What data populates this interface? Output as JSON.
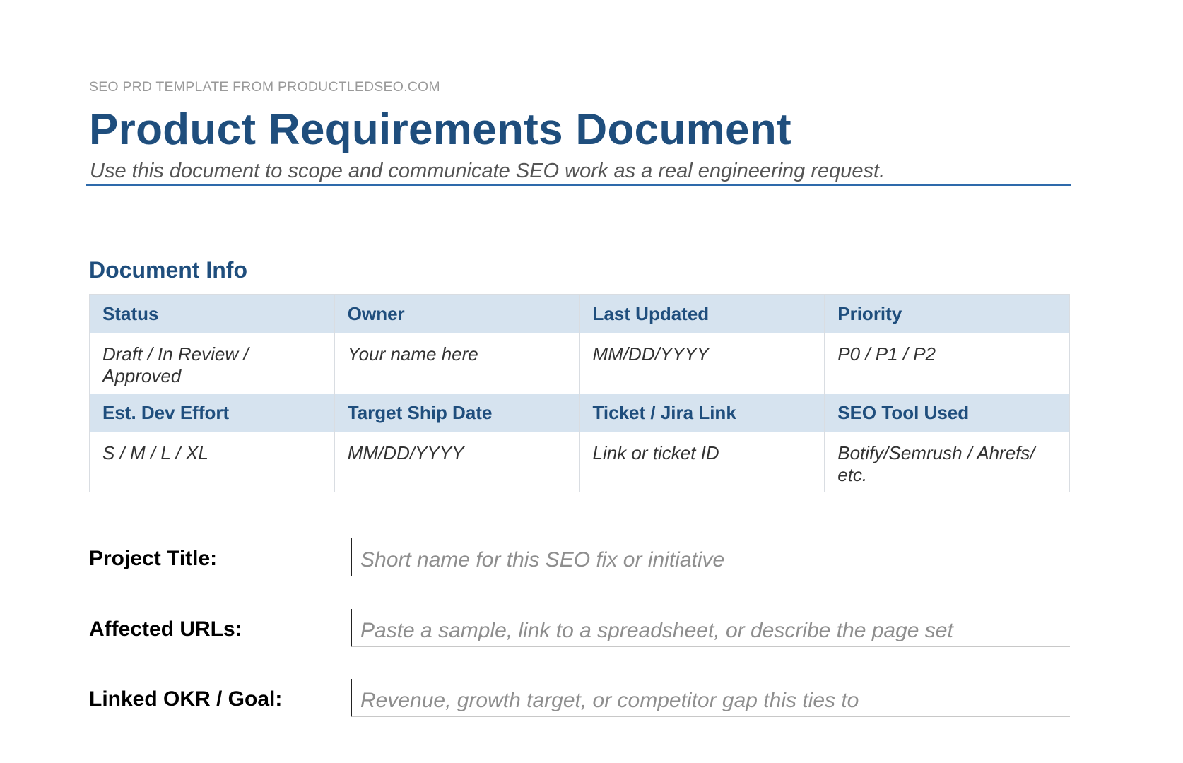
{
  "header": {
    "eyebrow": "SEO PRD TEMPLATE FROM PRODUCTLEDSEO.COM",
    "title": "Product Requirements Document",
    "subtitle": "Use this document to scope and communicate SEO work as a real engineering request."
  },
  "document_info": {
    "heading": "Document Info",
    "rows": [
      {
        "headers": [
          "Status",
          "Owner",
          "Last Updated",
          "Priority"
        ],
        "values": [
          "Draft / In Review / Approved",
          "Your name here",
          "MM/DD/YYYY",
          "P0 / P1 / P2"
        ]
      },
      {
        "headers": [
          "Est. Dev Effort",
          "Target Ship Date",
          "Ticket / Jira Link",
          "SEO Tool Used"
        ],
        "values": [
          "S / M / L / XL",
          "MM/DD/YYYY",
          "Link or ticket ID",
          "Botify/Semrush / Ahrefs/ etc."
        ]
      }
    ]
  },
  "fields": [
    {
      "label": "Project Title:",
      "value": "",
      "placeholder": "Short name for this SEO fix or initiative"
    },
    {
      "label": "Affected URLs:",
      "value": "",
      "placeholder": "Paste a sample, link to a spreadsheet, or describe the page set"
    },
    {
      "label": "Linked OKR / Goal:",
      "value": "",
      "placeholder": "Revenue, growth target, or competitor gap this ties to"
    }
  ],
  "colors": {
    "accent": "#1f4e7d",
    "rule": "#2e6aab",
    "table_header_bg": "#d6e3ef"
  }
}
